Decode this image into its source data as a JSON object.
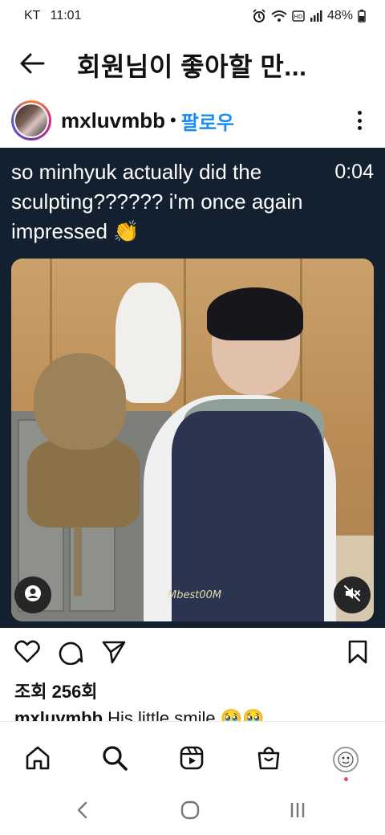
{
  "status_bar": {
    "carrier": "KT",
    "time": "11:01",
    "battery": "48%",
    "icons": [
      "alarm-icon",
      "wifi-icon",
      "hd-icon",
      "signal-icon",
      "battery-icon"
    ]
  },
  "header": {
    "title": "회원님이 좋아할 만...",
    "back_icon": "back-arrow-icon"
  },
  "post": {
    "username": "mxluvmbb",
    "separator": "•",
    "follow_label": "팔로우",
    "more_icon": "more-vertical-icon"
  },
  "video": {
    "caption": "so minhyuk actually did the sculpting?????? i'm once again impressed 👏",
    "timer": "0:04",
    "watermark": "Mbest00M",
    "user_tag_icon": "user-tag-icon",
    "mute_icon": "muted-speaker-icon"
  },
  "actions": {
    "like_icon": "heart-icon",
    "comment_icon": "comment-icon",
    "share_icon": "send-icon",
    "save_icon": "bookmark-icon"
  },
  "stats": {
    "views": "조회 256회"
  },
  "caption_preview": {
    "username": "mxluvmbb",
    "text": "His little smile 🥹🥹"
  },
  "bottom_nav": {
    "items": [
      "home-icon",
      "search-icon",
      "reels-icon",
      "shop-icon",
      "profile-avatar"
    ]
  },
  "system_nav": {
    "items": [
      "back-icon",
      "home-circle-icon",
      "recents-icon"
    ]
  },
  "colors": {
    "accent": "#1a8cf0",
    "video_bg": "#12202f",
    "notification_dot": "#ed4956"
  }
}
